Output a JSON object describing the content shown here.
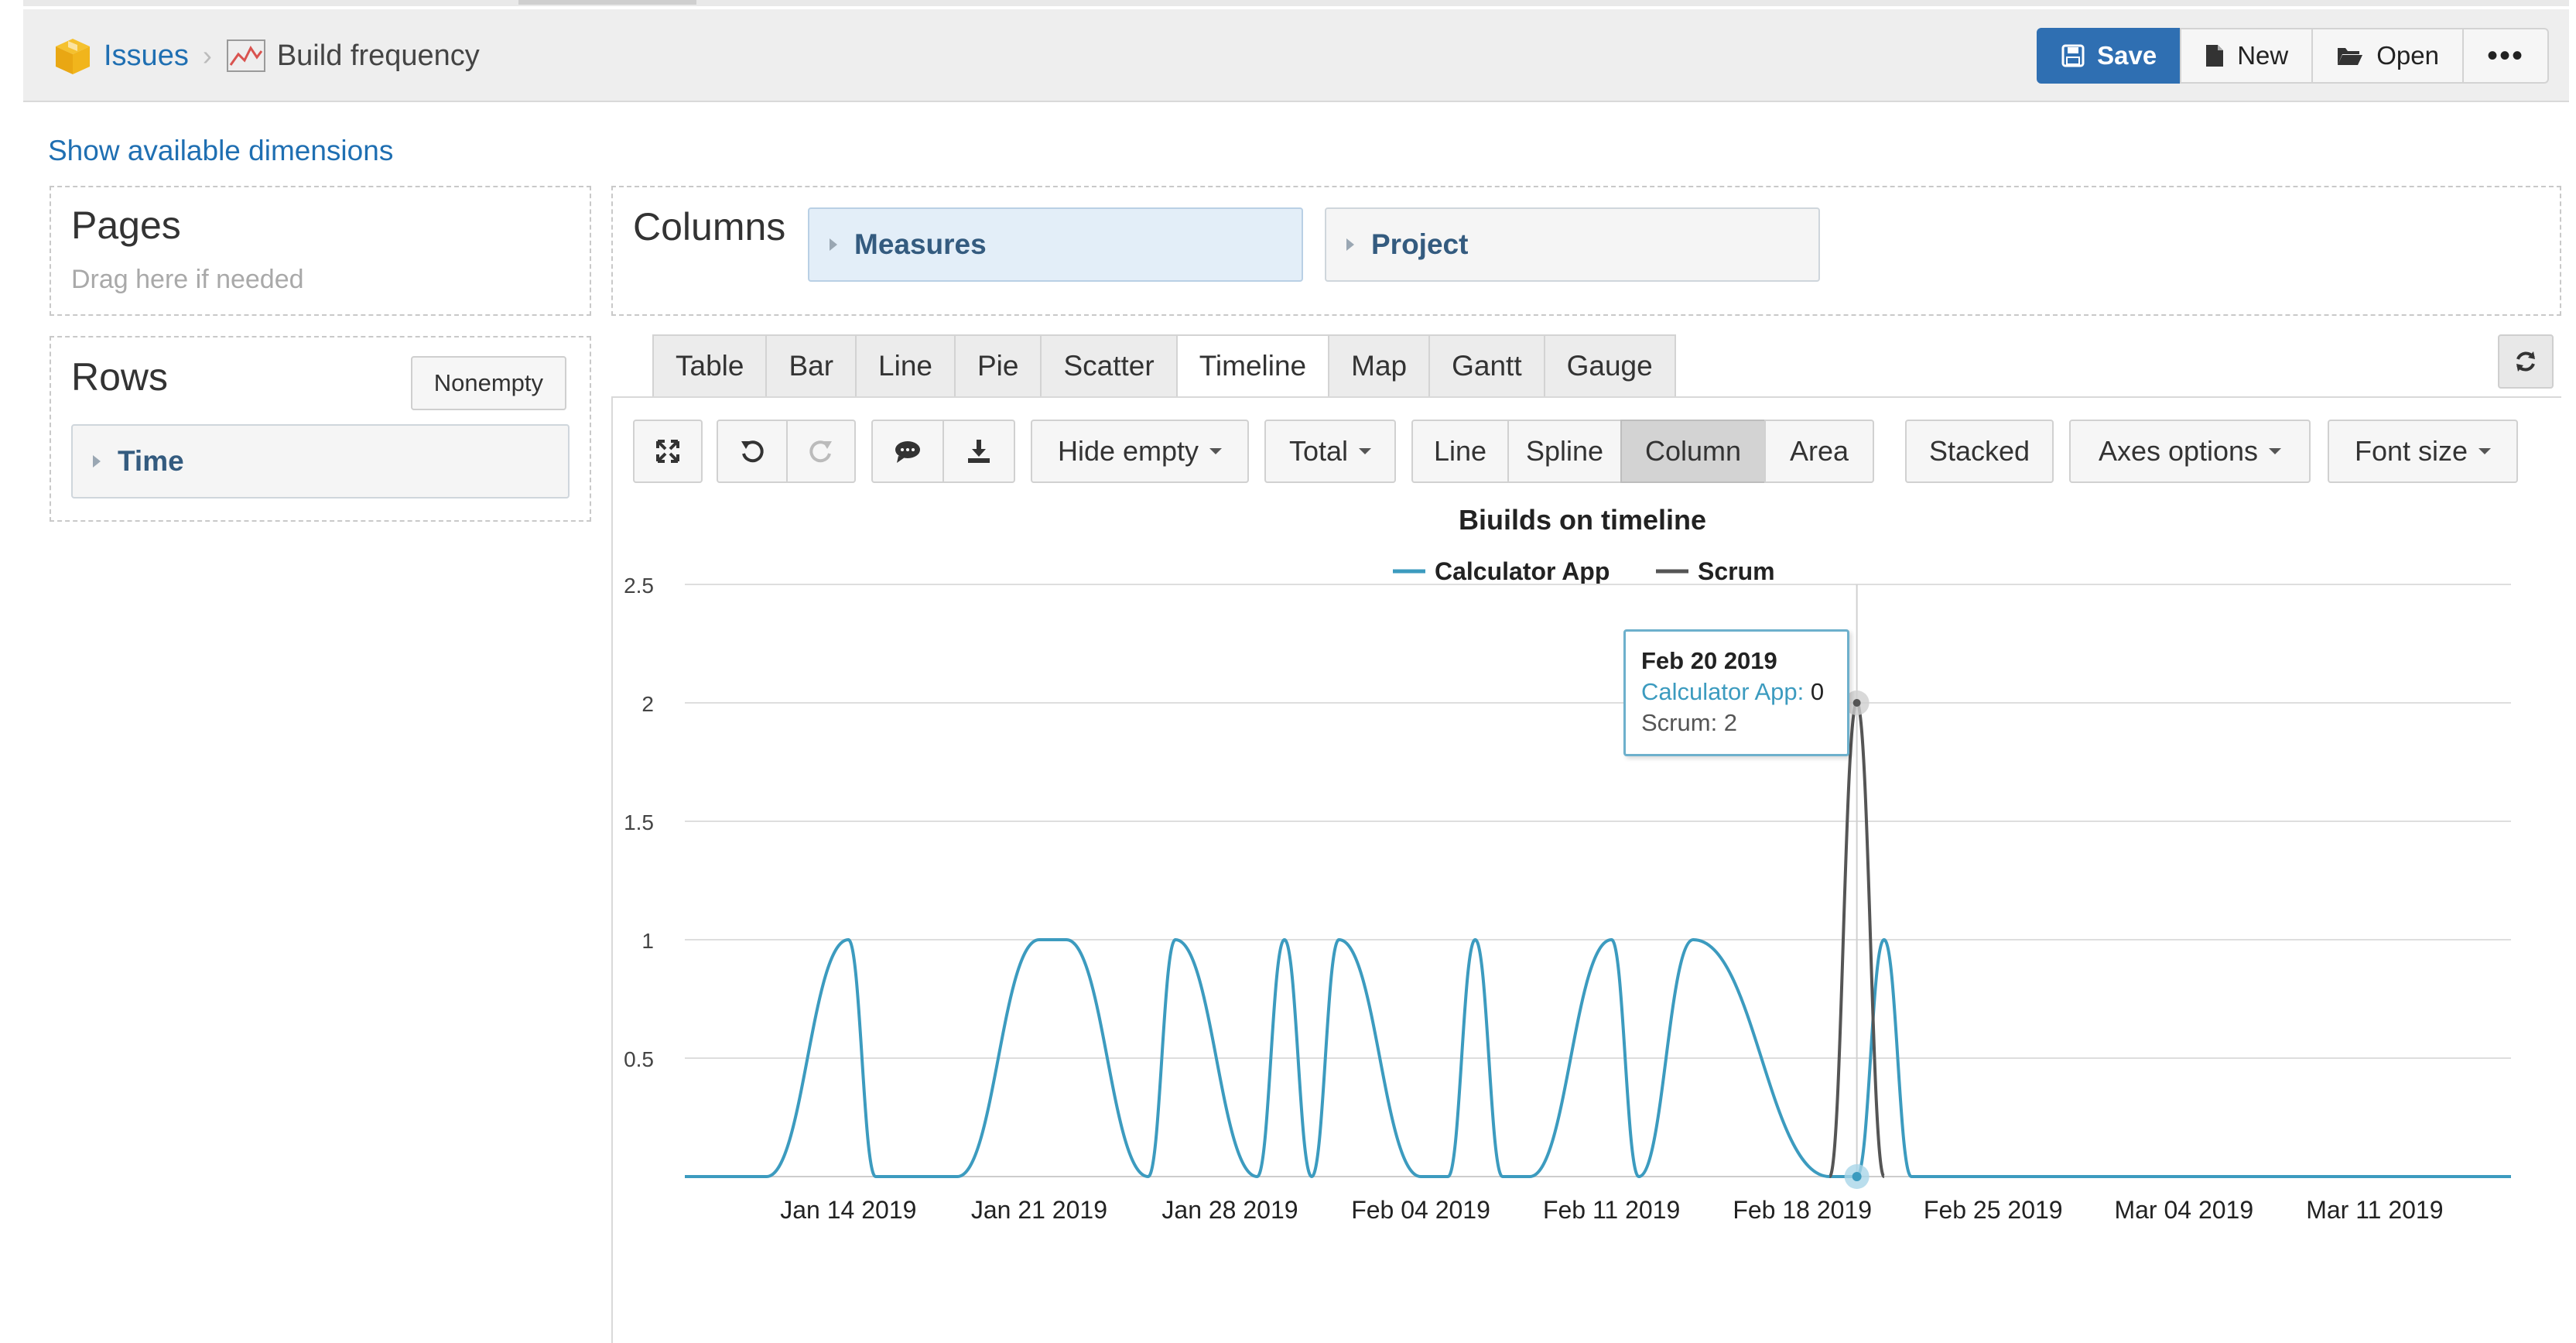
{
  "header": {
    "breadcrumb_root": "Issues",
    "breadcrumb_separator": "›",
    "report_title": "Build frequency",
    "actions": {
      "save": "Save",
      "new": "New",
      "open": "Open",
      "more": "•••"
    }
  },
  "layout_panel": {
    "show_dimensions": "Show available dimensions",
    "pages": {
      "title": "Pages",
      "hint": "Drag here if needed"
    },
    "rows": {
      "title": "Rows",
      "nonempty_button": "Nonempty",
      "items": [
        "Time"
      ]
    },
    "columns": {
      "title": "Columns",
      "items": [
        "Measures",
        "Project"
      ]
    }
  },
  "chart_types": [
    "Table",
    "Bar",
    "Line",
    "Pie",
    "Scatter",
    "Timeline",
    "Map",
    "Gantt",
    "Gauge"
  ],
  "active_chart_type": "Timeline",
  "toolbar": {
    "hide_empty": "Hide empty",
    "total": "Total",
    "series_types": [
      "Line",
      "Spline",
      "Column",
      "Area"
    ],
    "selected_series_type": "Column",
    "stacked": "Stacked",
    "axes_options": "Axes options",
    "font_size": "Font size"
  },
  "tooltip": {
    "date": "Feb 20 2019",
    "series1_label": "Calculator App: ",
    "series1_value": "0",
    "series2_label": "Scrum: ",
    "series2_value": "2"
  },
  "colors": {
    "accent": "#2f6fb2",
    "series_calculator": "#3c9bbf",
    "series_scrum": "#555555"
  },
  "chart_data": {
    "type": "line",
    "title": "Biuilds on timeline",
    "xlabel": "",
    "ylabel": "",
    "ylim": [
      0,
      2.5
    ],
    "y_ticks": [
      "0.5",
      "1",
      "1.5",
      "2",
      "2.5"
    ],
    "x_ticks": [
      "Jan 14 2019",
      "Jan 21 2019",
      "Jan 28 2019",
      "Feb 04 2019",
      "Feb 11 2019",
      "Feb 18 2019",
      "Feb 25 2019",
      "Mar 04 2019",
      "Mar 11 2019"
    ],
    "x_range": [
      "2019-01-08",
      "2019-03-16"
    ],
    "legend_position": "top",
    "grid": true,
    "series": [
      {
        "name": "Calculator App",
        "points": [
          [
            "2019-01-08",
            0
          ],
          [
            "2019-01-11",
            0
          ],
          [
            "2019-01-14",
            1
          ],
          [
            "2019-01-15",
            0
          ],
          [
            "2019-01-18",
            0
          ],
          [
            "2019-01-21",
            1
          ],
          [
            "2019-01-22",
            1
          ],
          [
            "2019-01-25",
            0
          ],
          [
            "2019-01-26",
            1
          ],
          [
            "2019-01-29",
            0
          ],
          [
            "2019-01-30",
            1
          ],
          [
            "2019-01-31",
            0
          ],
          [
            "2019-02-01",
            1
          ],
          [
            "2019-02-04",
            0
          ],
          [
            "2019-02-05",
            0
          ],
          [
            "2019-02-06",
            1
          ],
          [
            "2019-02-07",
            0
          ],
          [
            "2019-02-08",
            0
          ],
          [
            "2019-02-11",
            1
          ],
          [
            "2019-02-12",
            0
          ],
          [
            "2019-02-14",
            1
          ],
          [
            "2019-02-19",
            0
          ],
          [
            "2019-02-20",
            0
          ],
          [
            "2019-02-21",
            1
          ],
          [
            "2019-02-22",
            0
          ],
          [
            "2019-03-16",
            0
          ]
        ]
      },
      {
        "name": "Scrum",
        "points": [
          [
            "2019-02-19",
            0
          ],
          [
            "2019-02-20",
            2
          ],
          [
            "2019-02-21",
            0
          ]
        ]
      }
    ],
    "highlight": {
      "date": "2019-02-20",
      "calculator_app": 0,
      "scrum": 2
    }
  }
}
